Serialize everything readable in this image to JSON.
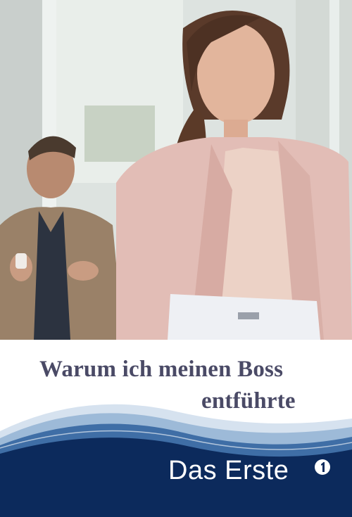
{
  "poster": {
    "title_line1": "Warum ich meinen Boss",
    "title_line2": "entführte",
    "channel": "Das Erste",
    "logo_icon": "ard-one-logo",
    "colors": {
      "title": "#4a4a66",
      "band_dark": "#0c2a5c",
      "band_light": "#8fb3d6",
      "background": "#ffffff"
    }
  }
}
